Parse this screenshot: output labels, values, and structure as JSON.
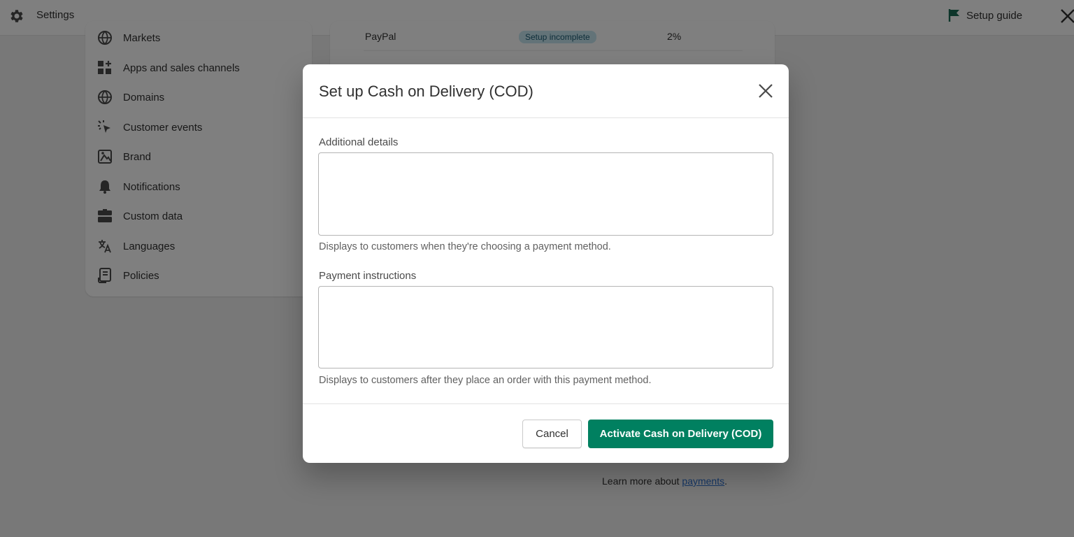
{
  "topbar": {
    "title": "Settings",
    "setup_guide": "Setup guide",
    "icons": {
      "settings": "gear-icon",
      "guide": "flag-icon",
      "close": "close-icon"
    }
  },
  "sidebar": {
    "items": [
      {
        "label": "Markets",
        "icon": "globe-icon"
      },
      {
        "label": "Apps and sales channels",
        "icon": "apps-icon"
      },
      {
        "label": "Domains",
        "icon": "globe-icon"
      },
      {
        "label": "Customer events",
        "icon": "cursor-click-icon"
      },
      {
        "label": "Brand",
        "icon": "brand-icon"
      },
      {
        "label": "Notifications",
        "icon": "bell-icon"
      },
      {
        "label": "Custom data",
        "icon": "database-icon"
      },
      {
        "label": "Languages",
        "icon": "translate-icon"
      },
      {
        "label": "Policies",
        "icon": "document-icon"
      }
    ]
  },
  "background_card": {
    "provider": "PayPal",
    "status_badge": "Setup incomplete",
    "fee": "2%"
  },
  "footer_link": {
    "prefix": "Learn more about ",
    "link": "payments",
    "suffix": "."
  },
  "modal": {
    "title": "Set up Cash on Delivery (COD)",
    "fields": [
      {
        "label": "Additional details",
        "value": "",
        "help": "Displays to customers when they're choosing a payment method."
      },
      {
        "label": "Payment instructions",
        "value": "",
        "help": "Displays to customers after they place an order with this payment method."
      }
    ],
    "cancel_label": "Cancel",
    "activate_label": "Activate Cash on Delivery (COD)"
  },
  "colors": {
    "primary": "#008060",
    "overlay": "rgba(0,0,0,0.5)",
    "badge_bg": "#c6e7f1",
    "link": "#2c6ecb"
  }
}
